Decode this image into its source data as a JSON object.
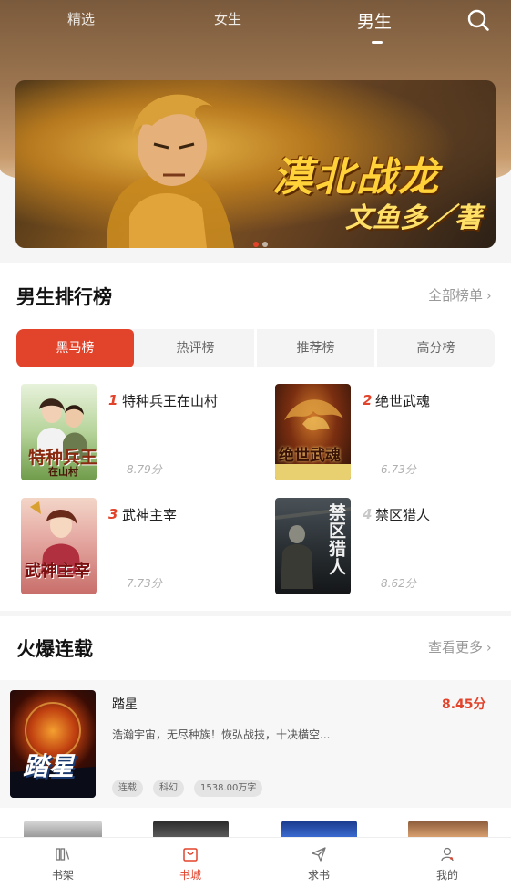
{
  "top_tabs": [
    {
      "label": "精选",
      "active": false
    },
    {
      "label": "女生",
      "active": false
    },
    {
      "label": "男生",
      "active": true
    }
  ],
  "banner": {
    "title": "漠北战龙",
    "author": "文鱼多／著",
    "page_index": 1,
    "page_count": 2
  },
  "ranking": {
    "title": "男生排行榜",
    "more_label": "全部榜单",
    "tabs": [
      {
        "label": "黑马榜",
        "active": true
      },
      {
        "label": "热评榜",
        "active": false
      },
      {
        "label": "推荐榜",
        "active": false
      },
      {
        "label": "高分榜",
        "active": false
      }
    ],
    "books": [
      {
        "rank": "1",
        "name": "特种兵王在山村",
        "score": "8.79分",
        "cover_text": "特种兵王",
        "cover_subtext": "在山村"
      },
      {
        "rank": "2",
        "name": "绝世武魂",
        "score": "6.73分",
        "cover_text": "绝世武魂",
        "cover_subtext": ""
      },
      {
        "rank": "3",
        "name": "武神主宰",
        "score": "7.73分",
        "cover_text": "武神主宰",
        "cover_subtext": ""
      },
      {
        "rank": "4",
        "name": "禁区猎人",
        "score": "8.62分",
        "cover_text": "禁区猎人",
        "cover_subtext": ""
      }
    ]
  },
  "serial": {
    "title": "火爆连载",
    "more_label": "查看更多",
    "featured": {
      "name": "踏星",
      "score": "8.45分",
      "description": "浩瀚宇宙，无尽种族！恢弘战技，十决横空...",
      "cover_text": "踏星",
      "tags": [
        "连载",
        "科幻",
        "1538.00万字"
      ]
    }
  },
  "bottom_nav": [
    {
      "label": "书架",
      "icon": "bookshelf-icon",
      "active": false
    },
    {
      "label": "书城",
      "icon": "bookstore-bag-icon",
      "active": true
    },
    {
      "label": "求书",
      "icon": "paper-plane-icon",
      "active": false
    },
    {
      "label": "我的",
      "icon": "user-icon",
      "active": false
    }
  ],
  "colors": {
    "accent": "#e2432b",
    "header_brown": "#9d7650",
    "muted_text": "#999999"
  }
}
